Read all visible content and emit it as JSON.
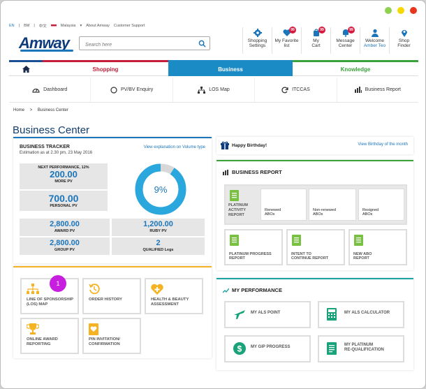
{
  "window": {
    "dots": [
      "#8fd14f",
      "#f5d800",
      "#e8351e"
    ]
  },
  "utility": {
    "lang_en": "EN",
    "lang_bm": "BM",
    "lang_cn": "中文",
    "country": "Malaysia",
    "about": "About Amway",
    "support": "Customer Support"
  },
  "logo": "Amway",
  "search": {
    "placeholder": "Search here"
  },
  "navicons": [
    {
      "label1": "Shopping",
      "label2": "Settings",
      "icon": "gear-icon"
    },
    {
      "label1": "My Favorite",
      "label2": "list",
      "badge": "99",
      "icon": "heart-icon"
    },
    {
      "label1": "My",
      "label2": "Cart",
      "badge": "99",
      "icon": "cart-icon"
    },
    {
      "label1": "Message",
      "label2": "Center",
      "badge": "99",
      "icon": "message-icon"
    },
    {
      "label1": "Welcome",
      "label2": "Amber Teo",
      "icon": "user-icon"
    },
    {
      "label1": "Shop",
      "label2": "Finder",
      "icon": "location-icon"
    }
  ],
  "mainnav": {
    "shopping": "Shopping",
    "business": "Business",
    "knowledge": "Knowledge"
  },
  "subnav": [
    "Dashboard",
    "PV/BV Enquiry",
    "LOS Map",
    "ITCCAS",
    "Business Report"
  ],
  "breadcrumb": {
    "home": "Home",
    "sep": ">",
    "current": "Business Center"
  },
  "page_title": "Business Center",
  "tracker": {
    "title": "BUSINESS TRACKER",
    "estimation": "Estimation as at 2.30 pm, 23 May 2016",
    "view_link": "View explanation on Volume type",
    "next_perf_label": "NEXT PERFORMANCE, 12%",
    "more_pv_value": "200.00",
    "more_pv_label": "MORE PV",
    "personal_pv_value": "700.00",
    "personal_pv_label": "PERSONAL PV",
    "percent": "9%",
    "percent_fill": 0.09,
    "award_pv_value": "2,800.00",
    "award_pv_label": "AWARD PV",
    "ruby_pv_value": "1,200.00",
    "ruby_pv_label": "RUBY PV",
    "group_pv_value": "2,800.00",
    "group_pv_label": "GROUP PV",
    "qualified_legs_value": "2",
    "qualified_legs_label": "QUALIFIED Legs"
  },
  "birthday": {
    "text": "Happy Birthday!",
    "link": "View Birthday of the month"
  },
  "report": {
    "title": "BUSINESS REPORT",
    "platinum_activity": [
      "PLATINUM",
      "ACTIVITY",
      "REPORT"
    ],
    "renewed": [
      "Renewed",
      "ABOs"
    ],
    "non_renewed": [
      "Non-renewed",
      "ABOs"
    ],
    "resigned": [
      "Resigned",
      "ABOs"
    ],
    "platinum_progress": [
      "PLATINUM PROGRESS",
      "REPORT"
    ],
    "intent": [
      "INTENT TO",
      "CONTINUE REPORT"
    ],
    "new_abo": [
      "NEW ABO",
      "REPORT"
    ]
  },
  "performance": {
    "title": "MY PERFORMANCE",
    "als_point": "MY ALS POINT",
    "als_calc": "MY ALS CALCULATOR",
    "gip": "MY GIP PROGRESS",
    "requal": [
      "MY PLATINUM",
      "RE-QUALIFICATION"
    ]
  },
  "tools": {
    "los": [
      "LINE OF SPONSORSHIP",
      "(LOS) MAP"
    ],
    "order_history": "ORDER HISTORY",
    "health": [
      "HEALTH & BEAUTY",
      "ASSESSMENT"
    ],
    "award": [
      "ONLINE AWARD",
      "REPORTING"
    ],
    "pin": [
      "PIN INVITATION/",
      "CONFIRMATION"
    ]
  },
  "marker": "1"
}
